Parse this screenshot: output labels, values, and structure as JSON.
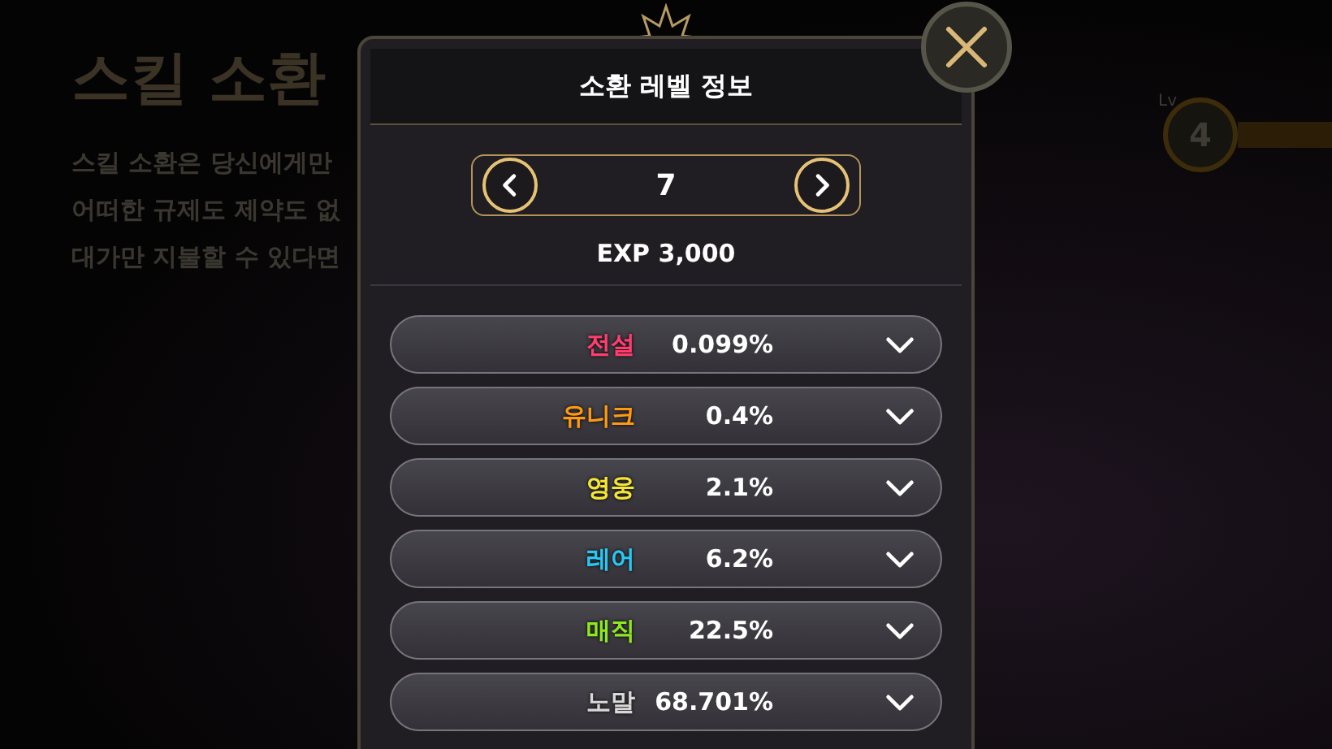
{
  "background": {
    "title": "스킬 소환",
    "lines": [
      "스킬 소환은 당신에게만",
      "어떠한 규제도 제약도 없",
      "대가만 지불할 수 있다면"
    ],
    "level_badge": {
      "prefix": "Lv",
      "value": "4"
    }
  },
  "dialog": {
    "title": "소환 레벨 정보",
    "level": "7",
    "exp": "EXP 3,000",
    "rates": [
      {
        "grade": "전설",
        "color": "#ff3d6e",
        "rate": "0.099%",
        "expanded": false
      },
      {
        "grade": "유니크",
        "color": "#ff9a10",
        "rate": "0.4%",
        "expanded": false
      },
      {
        "grade": "영웅",
        "color": "#f5e636",
        "rate": "2.1%",
        "expanded": false
      },
      {
        "grade": "레어",
        "color": "#28c8f5",
        "rate": "6.2%",
        "expanded": false
      },
      {
        "grade": "매직",
        "color": "#8ee81e",
        "rate": "22.5%",
        "expanded": false
      },
      {
        "grade": "노말",
        "color": "#d8d8d8",
        "rate": "68.701%",
        "expanded": false
      }
    ]
  }
}
